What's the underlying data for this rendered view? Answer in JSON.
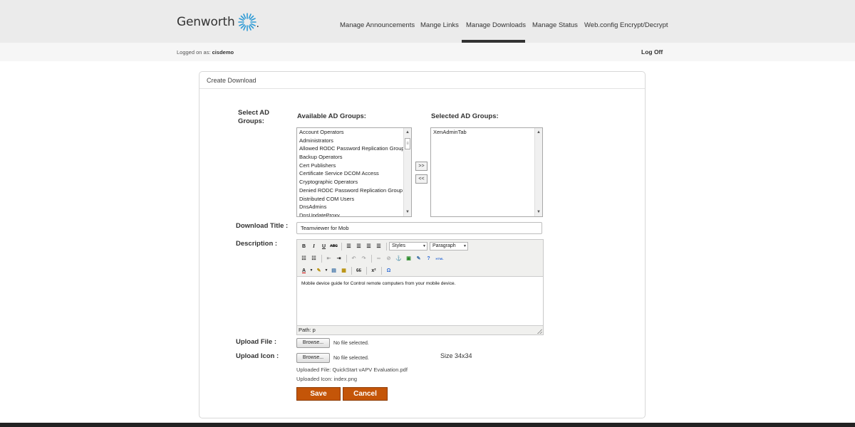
{
  "brand": {
    "name": "Genworth",
    "dot": "."
  },
  "nav": {
    "items": [
      {
        "label": "Manage Announcements"
      },
      {
        "label": "Mange Links"
      },
      {
        "label": "Manage Downloads"
      },
      {
        "label": "Manage Status"
      },
      {
        "label": "Web.config Encrypt/Decrypt"
      }
    ],
    "active": "Manage Downloads"
  },
  "session": {
    "logged_prefix": "Logged on as:",
    "user": "cisdemo",
    "logoff": "Log Off"
  },
  "panel": {
    "title": "Create Download"
  },
  "form": {
    "select_groups_label": "Select AD Groups:",
    "available_header": "Available AD Groups:",
    "selected_header": "Selected AD Groups:",
    "available_groups": [
      "Account Operators",
      "Administrators",
      "Allowed RODC Password Replication Group",
      "Backup Operators",
      "Cert Publishers",
      "Certificate Service DCOM Access",
      "Cryptographic Operators",
      "Denied RODC Password Replication Group",
      "Distributed COM Users",
      "DnsAdmins",
      "DnsUpdateProxy"
    ],
    "selected_groups": [
      "XenAdminTab"
    ],
    "move_right": ">>",
    "move_left": "<<",
    "title_label": "Download Title :",
    "title_value": "Teamviewer for Mob",
    "description_label": "Description :",
    "editor": {
      "styles": "Styles",
      "paragraph": "Paragraph",
      "body": "Mobile device guide for Control remote computers from your mobile device.",
      "path": "Path: p",
      "tb": {
        "bold": "B",
        "italic": "I",
        "underline": "U",
        "strike": "ABC",
        "superscript": "x²",
        "omega": "Ω",
        "quote": "66",
        "html": "HTML"
      }
    },
    "upload_file_label": "Upload File :",
    "upload_icon_label": "Upload Icon :",
    "browse": "Browse...",
    "no_file": "No file selected.",
    "size_note": "Size 34x34",
    "uploaded_file": "Uploaded File: QuickStart vAPV Evaluation.pdf",
    "uploaded_icon": "Uploaded Icon: index.png",
    "save": "Save",
    "cancel": "Cancel"
  },
  "colors": {
    "action": "#c45508",
    "header_bg": "#ebebeb",
    "logo_blue": "#2e9bd6"
  }
}
